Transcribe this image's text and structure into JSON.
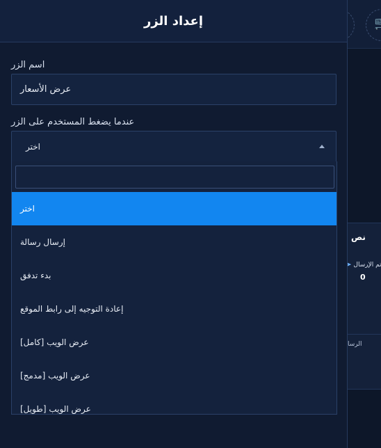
{
  "panel": {
    "title": "إعداد الزر",
    "button_name_label": "اسم الزر",
    "button_name_value": "عرض الأسعار",
    "on_click_label": "عندما يضغط المستخدم على الزر",
    "on_click_selected": "اختر",
    "search_placeholder": "",
    "options": [
      {
        "label": "اختر",
        "selected": true
      },
      {
        "label": "إرسال رسالة",
        "selected": false
      },
      {
        "label": "بدء تدفق",
        "selected": false
      },
      {
        "label": "إعادة التوجيه إلى رابط الموقع",
        "selected": false
      },
      {
        "label": "عرض الويب [كامل]",
        "selected": false
      },
      {
        "label": "عرض الويب [مدمج]",
        "selected": false
      },
      {
        "label": "عرض الويب [طويل]",
        "selected": false
      }
    ]
  },
  "background": {
    "card_title": "نص",
    "stat_label": "تم الإرسال",
    "stat_value": "0",
    "footer_text": "الرسا",
    "cart_icon": "cart-icon",
    "send_icon": "send-icon"
  },
  "colors": {
    "accent": "#1286f0",
    "panel_bg": "#101b31",
    "cart": "#f08a1c"
  }
}
